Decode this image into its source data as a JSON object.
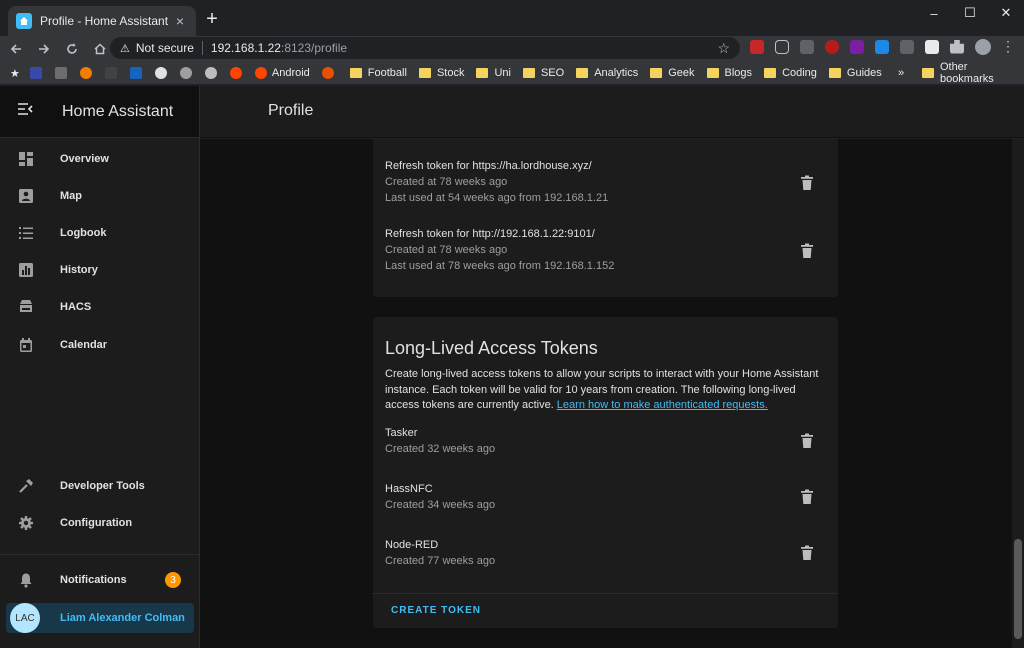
{
  "browser": {
    "tab_title": "Profile - Home Assistant",
    "tab_close": "×",
    "new_tab": "+",
    "minimize": "–",
    "maximize": "☐",
    "close": "✕",
    "security_text": "Not secure",
    "url_host": "192.168.1.22",
    "url_rest": ":8123/profile",
    "bookmarks": [
      "Android",
      "Football",
      "Stock",
      "Uni",
      "SEO",
      "Analytics",
      "Geek",
      "Blogs",
      "Coding",
      "Guides"
    ],
    "more_bookmarks": "»",
    "other_bookmarks": "Other bookmarks"
  },
  "sidebar": {
    "title": "Home Assistant",
    "items": [
      {
        "label": "Overview",
        "icon": "dashboard-icon"
      },
      {
        "label": "Map",
        "icon": "map-icon"
      },
      {
        "label": "Logbook",
        "icon": "logbook-icon"
      },
      {
        "label": "History",
        "icon": "history-icon"
      },
      {
        "label": "HACS",
        "icon": "hacs-icon"
      },
      {
        "label": "Calendar",
        "icon": "calendar-icon"
      }
    ],
    "bottom": [
      {
        "label": "Developer Tools",
        "icon": "hammer-icon"
      },
      {
        "label": "Configuration",
        "icon": "gear-icon"
      }
    ],
    "notifications": {
      "label": "Notifications",
      "count": "3"
    },
    "user": {
      "initials": "LAC",
      "name": "Liam Alexander Colman"
    }
  },
  "header": {
    "title": "Profile"
  },
  "refresh_tokens": [
    {
      "name": "Refresh token for https://ha.lordhouse.xyz/",
      "created": "Created at 78 weeks ago",
      "last_used": "Last used at 54 weeks ago from 192.168.1.21"
    },
    {
      "name": "Refresh token for http://192.168.1.22:9101/",
      "created": "Created at 78 weeks ago",
      "last_used": "Last used at 78 weeks ago from 192.168.1.152"
    }
  ],
  "long_lived": {
    "title": "Long-Lived Access Tokens",
    "description": "Create long-lived access tokens to allow your scripts to interact with your Home Assistant instance. Each token will be valid for 10 years from creation. The following long-lived access tokens are currently active. ",
    "link": "Learn how to make authenticated requests.",
    "tokens": [
      {
        "name": "Tasker",
        "created": "Created 32 weeks ago"
      },
      {
        "name": "HassNFC",
        "created": "Created 34 weeks ago"
      },
      {
        "name": "Node-RED",
        "created": "Created 77 weeks ago"
      }
    ],
    "create_button": "CREATE TOKEN"
  },
  "colors": {
    "accent": "#41bdf5",
    "badge": "#ff9800"
  }
}
